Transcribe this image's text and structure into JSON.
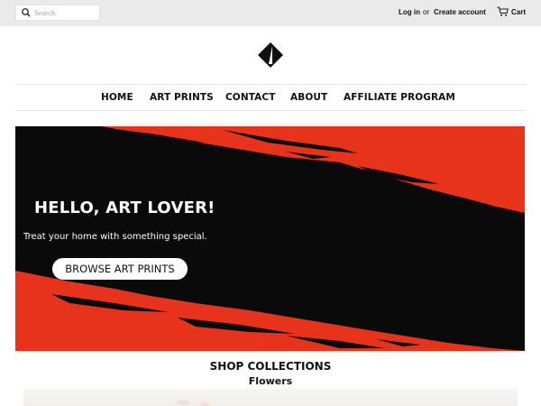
{
  "header": {
    "search": {
      "placeholder": "Search",
      "icon": "search-icon"
    },
    "login_label": "Log in",
    "or_label": "or",
    "create_account_label": "Create account",
    "cart_label": "Cart",
    "cart_icon": "cart-icon"
  },
  "logo": {
    "icon": "diamond-logo-icon"
  },
  "nav": {
    "items": [
      {
        "label": "HOME"
      },
      {
        "label": "ART PRINTS"
      },
      {
        "label": "CONTACT"
      },
      {
        "label": "ABOUT"
      },
      {
        "label": "AFFILIATE PROGRAM"
      }
    ]
  },
  "hero": {
    "title": "HELLO, ART LOVER!",
    "subtitle": "Treat your home with something special.",
    "cta_label": "Browse art prints",
    "colors": {
      "accent": "#e8331c",
      "dark": "#0a0a0a"
    }
  },
  "collections": {
    "title": "SHOP COLLECTIONS",
    "first_collection": "Flowers"
  }
}
